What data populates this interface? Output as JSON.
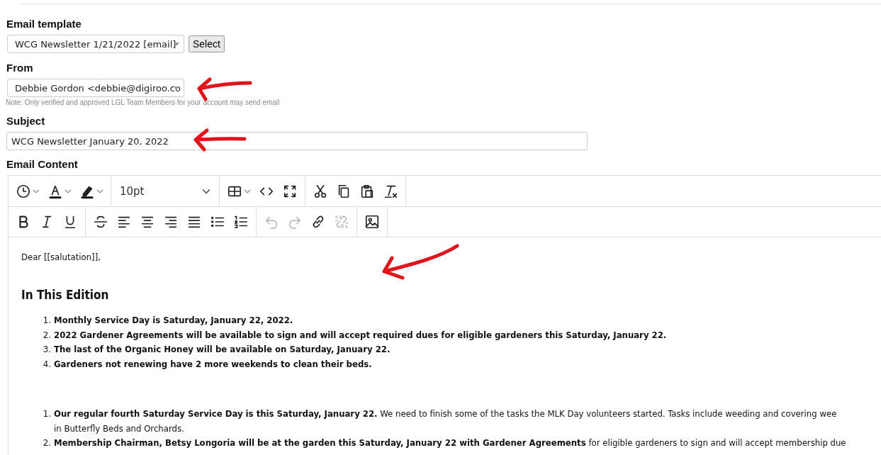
{
  "form": {
    "template": {
      "label": "Email template",
      "value": "WCG Newsletter 1/21/2022 [email]",
      "button": "Select"
    },
    "from": {
      "label": "From",
      "value": "Debbie Gordon <debbie@digiroo.co",
      "note": "Note: Only verified and approved LGL Team Members for your account may send email"
    },
    "subject": {
      "label": "Subject",
      "value": "WCG Newsletter January 20, 2022"
    },
    "content_label": "Email Content"
  },
  "toolbar": [
    [
      [
        {
          "kind": "clock",
          "dropdown": true,
          "disabled": false
        },
        {
          "kind": "text-color",
          "dropdown": true,
          "disabled": false
        },
        {
          "kind": "highlight",
          "dropdown": true,
          "disabled": false
        }
      ],
      [
        {
          "kind": "font-size",
          "value": "10pt",
          "dropdown": true,
          "disabled": false
        }
      ],
      [
        {
          "kind": "table",
          "dropdown": true,
          "disabled": false
        },
        {
          "kind": "code",
          "dropdown": false,
          "disabled": false
        },
        {
          "kind": "fullscreen",
          "dropdown": false,
          "disabled": false
        }
      ],
      [
        {
          "kind": "cut",
          "dropdown": false,
          "disabled": false
        },
        {
          "kind": "copy",
          "dropdown": false,
          "disabled": false
        },
        {
          "kind": "paste",
          "dropdown": false,
          "disabled": false
        },
        {
          "kind": "clear-format",
          "dropdown": false,
          "disabled": false
        }
      ]
    ],
    [
      [
        {
          "kind": "bold",
          "dropdown": false,
          "disabled": false
        },
        {
          "kind": "italic",
          "dropdown": false,
          "disabled": false
        },
        {
          "kind": "underline",
          "dropdown": false,
          "disabled": false
        }
      ],
      [
        {
          "kind": "strike",
          "dropdown": false,
          "disabled": false
        },
        {
          "kind": "align-left",
          "dropdown": false,
          "disabled": false
        },
        {
          "kind": "align-center",
          "dropdown": false,
          "disabled": false
        },
        {
          "kind": "align-right",
          "dropdown": false,
          "disabled": false
        },
        {
          "kind": "justify",
          "dropdown": false,
          "disabled": false
        },
        {
          "kind": "bullets",
          "dropdown": false,
          "disabled": false
        },
        {
          "kind": "numbers",
          "dropdown": false,
          "disabled": false
        }
      ],
      [
        {
          "kind": "undo",
          "dropdown": false,
          "disabled": true
        },
        {
          "kind": "redo",
          "dropdown": false,
          "disabled": true
        },
        {
          "kind": "link",
          "dropdown": false,
          "disabled": false
        },
        {
          "kind": "unlink",
          "dropdown": false,
          "disabled": true
        }
      ],
      [
        {
          "kind": "image",
          "dropdown": false,
          "disabled": false
        }
      ]
    ]
  ],
  "content": {
    "greeting": "Dear [[salutation]],",
    "heading": "In This Edition",
    "edition_items": [
      {
        "number": "1.",
        "text": "Monthly Service Day is Saturday, January 22, 2022."
      },
      {
        "number": "2.",
        "text": "2022 Gardener Agreements will be available to sign and will accept required dues for eligible gardeners this Saturday, January 22."
      },
      {
        "number": "3.",
        "text": "The last of the Organic Honey will be available on Saturday, January 22."
      },
      {
        "number": "4.",
        "text": "Gardeners not renewing have 2 more weekends to clean their beds."
      }
    ],
    "news_items": [
      {
        "number": "1.",
        "lines": [
          "**Our regular fourth Saturday Service Day is this Saturday, January 22.** We need to finish some of the tasks the MLK Day volunteers started. Tasks include weeding and covering wee",
          "in Butterfly Beds and Orchards."
        ]
      },
      {
        "number": "2.",
        "lines": [
          "**Membership Chairman, Betsy Longoria will be at the garden this Saturday, January 22 with Gardener Agreements** for eligible gardeners to sign and will accept membership due"
        ]
      }
    ]
  }
}
